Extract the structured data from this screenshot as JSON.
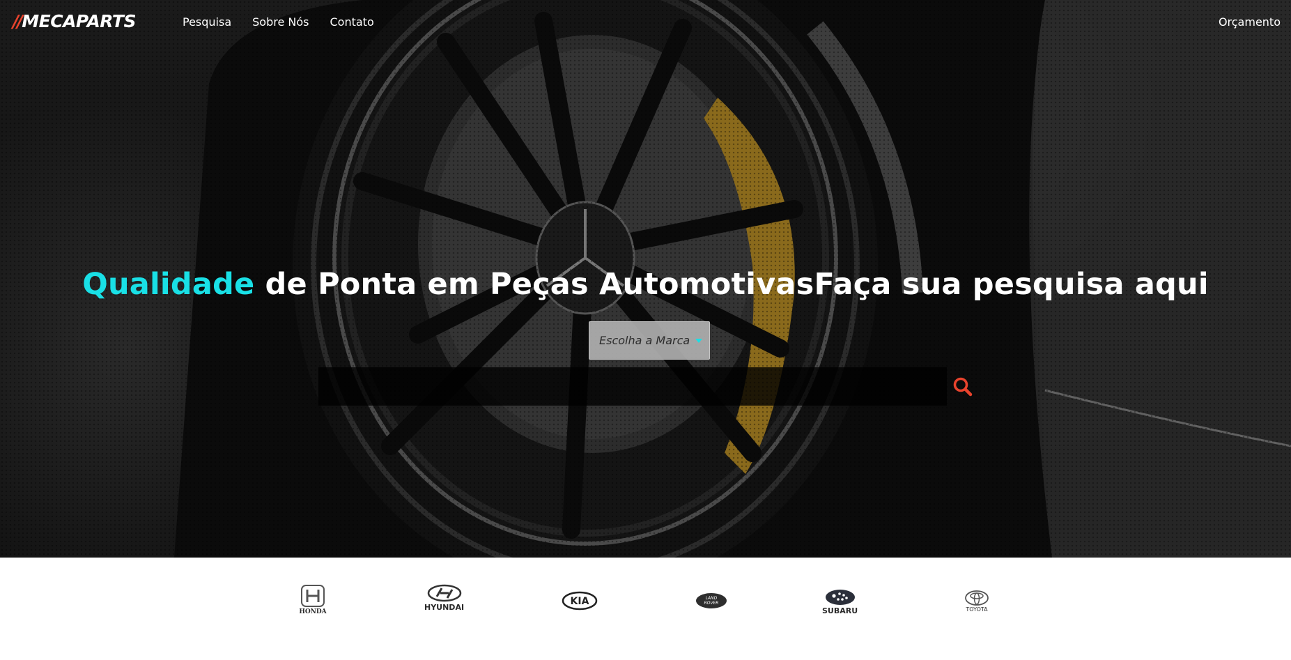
{
  "header": {
    "logo_slashes": "//",
    "logo_text": "MECAPARTS",
    "nav": [
      {
        "label": "Pesquisa"
      },
      {
        "label": "Sobre Nós"
      },
      {
        "label": "Contato"
      }
    ],
    "right_link": "Orçamento"
  },
  "hero": {
    "headline_accent": "Qualidade",
    "headline_rest": " de Ponta em Peças AutomotivasFaça sua pesquisa aqui",
    "accent_color": "#19e0e6",
    "brand_select": {
      "selected": "Escolha a Marca"
    },
    "search": {
      "value": "",
      "placeholder": "",
      "icon": "search-icon",
      "icon_color": "#e8432d"
    }
  },
  "brands": [
    {
      "name": "HONDA",
      "icon": "honda-logo-icon"
    },
    {
      "name": "HYUNDAI",
      "icon": "hyundai-logo-icon"
    },
    {
      "name": "KIA",
      "icon": "kia-logo-icon"
    },
    {
      "name": "LAND ROVER",
      "icon": "land-rover-logo-icon"
    },
    {
      "name": "SUBARU",
      "icon": "subaru-logo-icon"
    },
    {
      "name": "TOYOTA",
      "icon": "toyota-logo-icon"
    }
  ],
  "colors": {
    "brand_red": "#e8432d",
    "accent_cyan": "#19e0e6"
  }
}
